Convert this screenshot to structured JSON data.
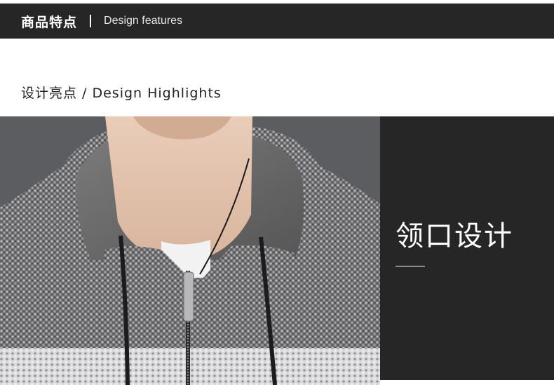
{
  "header": {
    "title": "商品特点",
    "subtitle": "Design features"
  },
  "section": {
    "heading": "设计亮点 / Design Highlights"
  },
  "feature": {
    "title": "领口设计"
  },
  "photo": {
    "subject": "hooded-knit-sweater-photo"
  },
  "colors": {
    "header_bg": "#262626",
    "panel_bg": "#262626",
    "page_bg": "#ffffff"
  }
}
